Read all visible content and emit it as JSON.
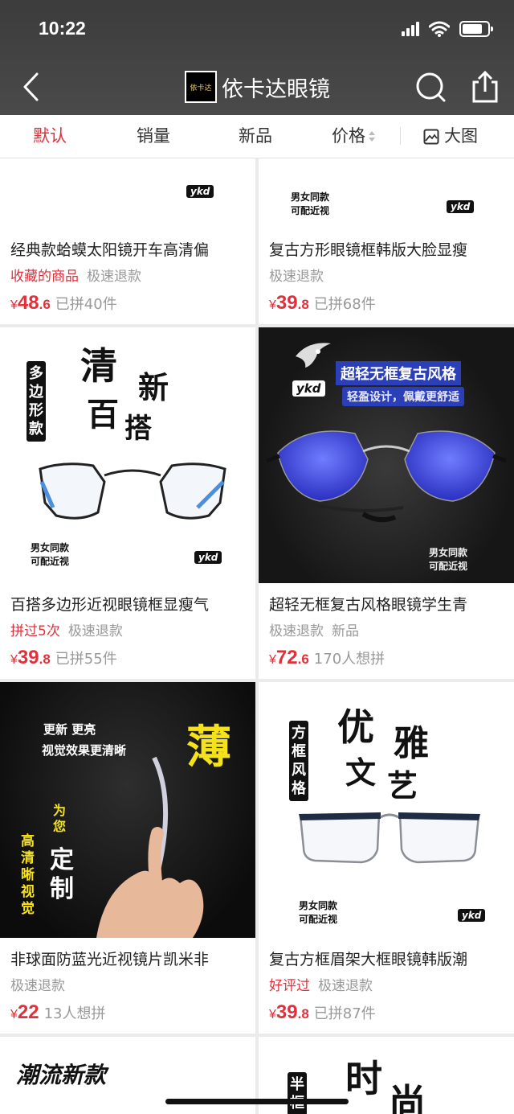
{
  "status": {
    "time": "10:22"
  },
  "header": {
    "shop_name": "依卡达眼镜",
    "logo_text": "依卡达"
  },
  "sort": {
    "items": [
      {
        "label": "默认",
        "active": true
      },
      {
        "label": "销量",
        "active": false
      },
      {
        "label": "新品",
        "active": false
      },
      {
        "label": "价格",
        "active": false
      }
    ],
    "bigview_label": "大图"
  },
  "brand_badge": "ykd",
  "image_text": {
    "couple_line1": "男女同款",
    "couple_line2": "可配近视",
    "c3_qing": "清",
    "c3_xin": "新",
    "c3_bai": "百",
    "c3_da": "搭",
    "c3_vertical": "多边形款",
    "c4_banner": "超轻无框复古风格",
    "c4_sub": "轻盈设计，佩戴更舒适",
    "c5_line1": "更新 更亮",
    "c5_line2": "视觉效果更清晰",
    "c5_bo": "薄",
    "c5_weini": "为您",
    "c5_dingzhi": "定制",
    "c5_vertical": "高清晰视觉",
    "c6_vertical": "方框风格",
    "c6_you": "优",
    "c6_ya": "雅",
    "c6_wen": "文",
    "c6_yi": "艺",
    "c7_text": "潮流新款",
    "c8_vertical": "半框",
    "c8_shi": "时",
    "c8_shang": "尚"
  },
  "products": [
    {
      "title": "经典款蛤蟆太阳镜开车高清偏",
      "tag_red": "收藏的商品",
      "tag_gray": "极速退款",
      "tag_gray2": "",
      "price_int": "48",
      "price_dec": ".6",
      "sold": "已拼40件"
    },
    {
      "title": "复古方形眼镜框韩版大脸显瘦",
      "tag_red": "",
      "tag_gray": "极速退款",
      "tag_gray2": "",
      "price_int": "39",
      "price_dec": ".8",
      "sold": "已拼68件"
    },
    {
      "title": "百搭多边形近视眼镜框显瘦气",
      "tag_red": "拼过5次",
      "tag_gray": "极速退款",
      "tag_gray2": "",
      "price_int": "39",
      "price_dec": ".8",
      "sold": "已拼55件"
    },
    {
      "title": "超轻无框复古风格眼镜学生青",
      "tag_red": "",
      "tag_gray": "极速退款",
      "tag_gray2": "新品",
      "price_int": "72",
      "price_dec": ".6",
      "sold": "170人想拼"
    },
    {
      "title": "非球面防蓝光近视镜片凯米非",
      "tag_red": "",
      "tag_gray": "极速退款",
      "tag_gray2": "",
      "price_int": "22",
      "price_dec": "",
      "sold": "13人想拼"
    },
    {
      "title": "复古方框眉架大框眼镜韩版潮",
      "tag_red": "好评过",
      "tag_gray": "极速退款",
      "tag_gray2": "",
      "price_int": "39",
      "price_dec": ".8",
      "sold": "已拼87件"
    }
  ],
  "currency": "¥",
  "colors": {
    "accent": "#e0303b",
    "header_bg": "#444444"
  }
}
